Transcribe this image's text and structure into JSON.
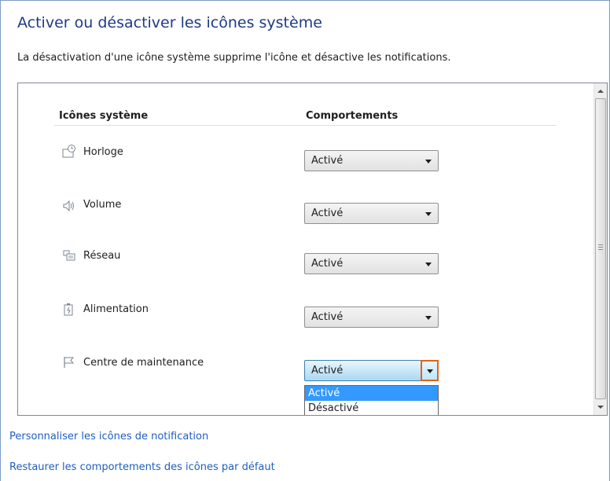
{
  "page": {
    "title": "Activer ou désactiver les icônes système",
    "description": "La désactivation d'une icône système supprime l'icône et désactive les notifications."
  },
  "table": {
    "headers": {
      "icons": "Icônes système",
      "behaviors": "Comportements"
    },
    "rows": [
      {
        "icon": "clock-icon",
        "label": "Horloge",
        "value": "Activé"
      },
      {
        "icon": "volume-icon",
        "label": "Volume",
        "value": "Activé"
      },
      {
        "icon": "network-icon",
        "label": "Réseau",
        "value": "Activé"
      },
      {
        "icon": "power-icon",
        "label": "Alimentation",
        "value": "Activé"
      },
      {
        "icon": "flag-icon",
        "label": "Centre de maintenance",
        "value": "Activé"
      }
    ]
  },
  "dropdown": {
    "options": [
      "Activé",
      "Désactivé"
    ],
    "highlighted": "Activé"
  },
  "links": {
    "customize": "Personnaliser les icônes de notification",
    "restore": "Restaurer les comportements des icônes par défaut"
  },
  "colors": {
    "title": "#1e3a87",
    "link": "#1f5ec2",
    "selection": "#3399ff",
    "focus_outline": "#e2621a"
  }
}
